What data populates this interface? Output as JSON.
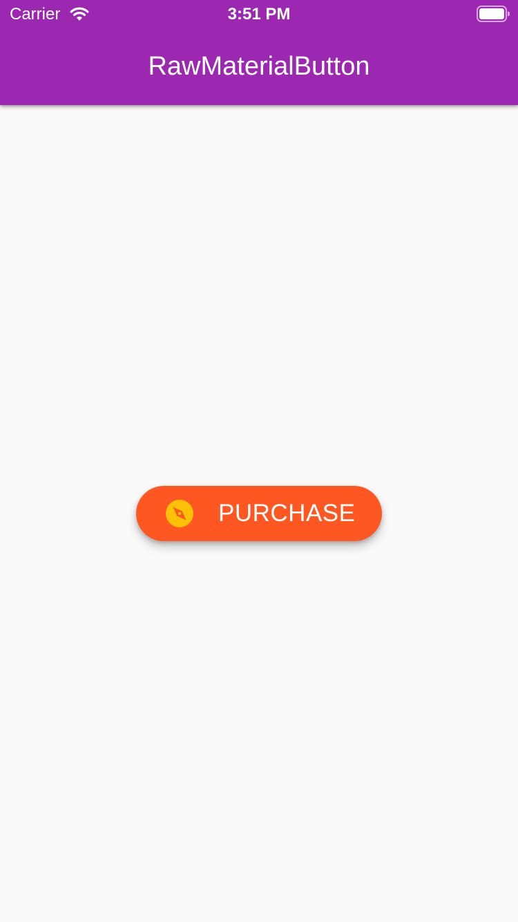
{
  "status_bar": {
    "carrier": "Carrier",
    "time": "3:51 PM",
    "icons": [
      "wifi-icon",
      "battery-icon"
    ]
  },
  "app_bar": {
    "title": "RawMaterialButton"
  },
  "main": {
    "purchase_button": {
      "label": "PURCHASE",
      "icon": "compass-icon"
    }
  },
  "colors": {
    "app_bar": "#9c27b0",
    "background": "#fafafa",
    "button": "#ff5722",
    "icon": "#ffc107",
    "text_on_primary": "#ffffff"
  }
}
